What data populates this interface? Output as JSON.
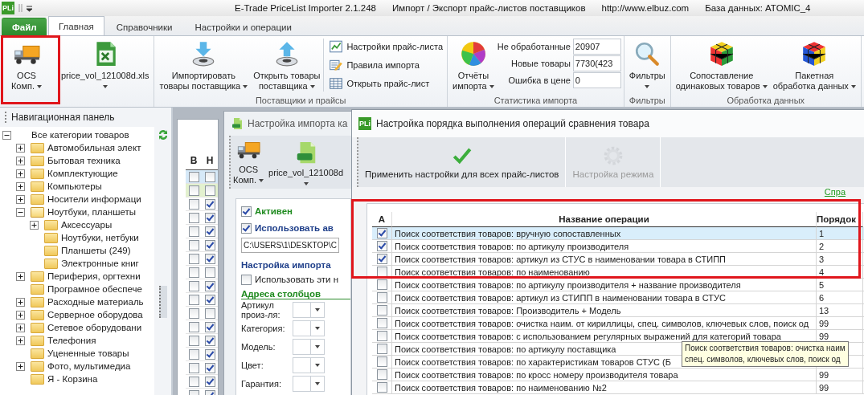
{
  "title_bar": {
    "app_icon": "PLi",
    "title": "E-Trade PriceList Importer 2.1.248",
    "subtitle": "Импорт / Экспорт прайс-листов поставщиков",
    "url": "http://www.elbuz.com",
    "database": "База данных: ATOMIC_4"
  },
  "ribbon_tabs": [
    {
      "label": "Файл",
      "kind": "file",
      "selected": false
    },
    {
      "label": "Главная",
      "kind": "tab",
      "selected": true
    },
    {
      "label": "Справочники",
      "kind": "tab",
      "selected": false
    },
    {
      "label": "Настройки и операции",
      "kind": "tab",
      "selected": false
    }
  ],
  "ribbon": {
    "groups": [
      {
        "buttons": [
          {
            "lines": [
              "OCS",
              "Комп."
            ],
            "dropdown": true
          },
          {
            "lines": [
              "price_vol_121008d.xls"
            ],
            "dropdown": true
          }
        ]
      },
      {
        "label": "Поставщики и прайсы",
        "buttons": [
          {
            "lines": [
              "Импортировать",
              "товары поставщика"
            ],
            "dropdown": true
          },
          {
            "lines": [
              "Открыть товары",
              "поставщика"
            ],
            "dropdown": true
          }
        ],
        "small_buttons": [
          {
            "label": "Настройки прайс-листа"
          },
          {
            "label": "Правила импорта"
          },
          {
            "label": "Открыть прайс-лист"
          }
        ]
      },
      {
        "label": "Статистика импорта",
        "buttons": [
          {
            "lines": [
              "Отчёты",
              "импорта"
            ],
            "dropdown": true
          }
        ],
        "stats": [
          {
            "label": "Не обработанные",
            "value": "20907"
          },
          {
            "label": "Новые товары",
            "value": "7730(423"
          },
          {
            "label": "Ошибка в цене",
            "value": "0"
          }
        ]
      },
      {
        "label": "Фильтры",
        "buttons": [
          {
            "lines": [
              "Фильтры"
            ],
            "dropdown": true
          }
        ]
      },
      {
        "label": "Обработка данных",
        "buttons": [
          {
            "lines": [
              "Сопоставление",
              "одинаковых товаров"
            ],
            "dropdown": true
          },
          {
            "lines": [
              "Пакетная",
              "обработка данных"
            ],
            "dropdown": true
          }
        ]
      }
    ]
  },
  "nav": {
    "title": "Навигационная панель",
    "root": {
      "label": "Все категории товаров",
      "kind": "root",
      "expanded": true,
      "children": [
        {
          "label": "Автомобильная элект",
          "kind": "branch",
          "expanded": false
        },
        {
          "label": "Бытовая техника",
          "kind": "branch",
          "expanded": false
        },
        {
          "label": "Комплектующие",
          "kind": "branch",
          "expanded": false
        },
        {
          "label": "Компьютеры",
          "kind": "branch",
          "expanded": false
        },
        {
          "label": "Носители информаци",
          "kind": "branch",
          "expanded": false
        },
        {
          "label": "Ноутбуки, планшеты",
          "kind": "branch",
          "expanded": true,
          "children": [
            {
              "label": "Аксессуары",
              "kind": "branch",
              "expanded": false
            },
            {
              "label": "Ноутбуки, нетбуки",
              "kind": "leaf"
            },
            {
              "label": "Планшеты (249)",
              "kind": "leaf"
            },
            {
              "label": "Электронные книг",
              "kind": "leaf"
            }
          ]
        },
        {
          "label": "Периферия, оргтехни",
          "kind": "branch",
          "expanded": false
        },
        {
          "label": "Програмное обеспече",
          "kind": "leaf"
        },
        {
          "label": "Расходные материаль",
          "kind": "branch",
          "expanded": false
        },
        {
          "label": "Серверное оборудова",
          "kind": "branch",
          "expanded": false
        },
        {
          "label": "Сетевое оборудовани",
          "kind": "branch",
          "expanded": false
        },
        {
          "label": "Телефония",
          "kind": "branch",
          "expanded": false
        },
        {
          "label": "Уцененные товары",
          "kind": "leaf"
        },
        {
          "label": "Фото, мультимедиа",
          "kind": "branch",
          "expanded": false
        },
        {
          "label": "Я - Корзина",
          "kind": "leaf"
        }
      ]
    }
  },
  "grid": {
    "columns": [
      "В",
      "Н"
    ],
    "rows": [
      {
        "b": false,
        "n": false,
        "color": "#d6e9f8"
      },
      {
        "b": false,
        "n": false,
        "color": "#e3f1cf"
      },
      {
        "b": false,
        "n": true,
        "color": "#ffffff"
      },
      {
        "b": false,
        "n": true,
        "color": "#ffffff"
      },
      {
        "b": false,
        "n": true,
        "color": "#ffffff"
      },
      {
        "b": false,
        "n": true,
        "color": "#ffffff"
      },
      {
        "b": false,
        "n": true,
        "color": "#ffffff"
      },
      {
        "b": false,
        "n": false,
        "color": "#ffffff"
      },
      {
        "b": false,
        "n": true,
        "color": "#ffffff"
      },
      {
        "b": false,
        "n": true,
        "color": "#ffffff"
      },
      {
        "b": false,
        "n": false,
        "color": "#ffffff"
      },
      {
        "b": false,
        "n": true,
        "color": "#ffffff"
      },
      {
        "b": false,
        "n": true,
        "color": "#ffffff"
      },
      {
        "b": false,
        "n": true,
        "color": "#ffffff"
      },
      {
        "b": false,
        "n": true,
        "color": "#ffffff"
      },
      {
        "b": false,
        "n": true,
        "color": "#ffffff"
      },
      {
        "b": false,
        "n": true,
        "color": "#ffffff"
      }
    ]
  },
  "import_window": {
    "title": "Настройка импорта ка",
    "toolbar": [
      {
        "lines": [
          "OCS",
          "Комп."
        ],
        "dropdown": true
      },
      {
        "lines": [
          "price_vol_121008d"
        ],
        "dropdown": true
      }
    ],
    "active": {
      "label": "Активен",
      "checked": true
    },
    "auto": {
      "label": "Использовать ав",
      "checked": true
    },
    "path": "C:\\USERS\\1\\DESKTOP\\C",
    "import_group": "Настройка импорта",
    "use_these": {
      "label": "Использовать эти н",
      "checked": false
    },
    "columns_heading": "Адреса столбцов",
    "column_fields": [
      "Артикул произ-ля:",
      "Категория:",
      "Модель:",
      "Цвет:",
      "Гарантия:"
    ]
  },
  "dialog": {
    "icon": "PLi",
    "title": "Настройка порядка выполнения операций сравнения товара",
    "toolbar": [
      {
        "label": "Применить настройки для всех прайс-листов",
        "disabled": false
      },
      {
        "label": "Настройка режима",
        "disabled": true
      }
    ],
    "help_link": "Спра",
    "columns": [
      "А",
      "Название операции",
      "Порядок"
    ],
    "rows": [
      {
        "checked": true,
        "name": "Поиск соответствия товаров: вручную сопоставленных",
        "order": "1",
        "selected": true
      },
      {
        "checked": true,
        "name": "Поиск соответствия товаров: по артикулу производителя",
        "order": "2",
        "selected": false
      },
      {
        "checked": true,
        "name": "Поиск соответствия товаров: артикул из СТУС в наименовании товара в СТИПП",
        "order": "3",
        "selected": false
      },
      {
        "checked": false,
        "name": "Поиск соответствия товаров: по наименованию",
        "order": "4",
        "selected": false
      },
      {
        "checked": false,
        "name": "Поиск соответствия товаров: по артикулу производителя + название производителя",
        "order": "5",
        "selected": false
      },
      {
        "checked": false,
        "name": "Поиск соответствия товаров: артикул из СТИПП в наименовании товара в СТУС",
        "order": "6",
        "selected": false
      },
      {
        "checked": false,
        "name": "Поиск соответствия товаров: Производитель + Модель",
        "order": "13",
        "selected": false
      },
      {
        "checked": false,
        "name": "Поиск соответствия товаров: очистка наим. от кириллицы, спец. символов, ключевых слов, поиск од",
        "order": "99",
        "selected": false
      },
      {
        "checked": false,
        "name": "Поиск соответствия товаров: с использованием регулярных выражений для категорий товара",
        "order": "99",
        "selected": false
      },
      {
        "checked": false,
        "name": "Поиск соответствия товаров: по артикулу поставщика",
        "selected": false
      },
      {
        "checked": false,
        "name": "Поиск соответствия товаров: по характеристикам товаров СТУС (Б",
        "selected": false
      },
      {
        "checked": false,
        "name": "Поиск соответствия товаров: по кросс номеру производителя товара",
        "order": "99",
        "selected": false
      },
      {
        "checked": false,
        "name": "Поиск соответствия товаров: по наименованию №2",
        "order": "99",
        "selected": false
      }
    ],
    "tooltip": {
      "lines": [
        "Поиск соответствия товаров: очистка наим",
        "спец. символов, ключевых слов, поиск од"
      ]
    }
  }
}
